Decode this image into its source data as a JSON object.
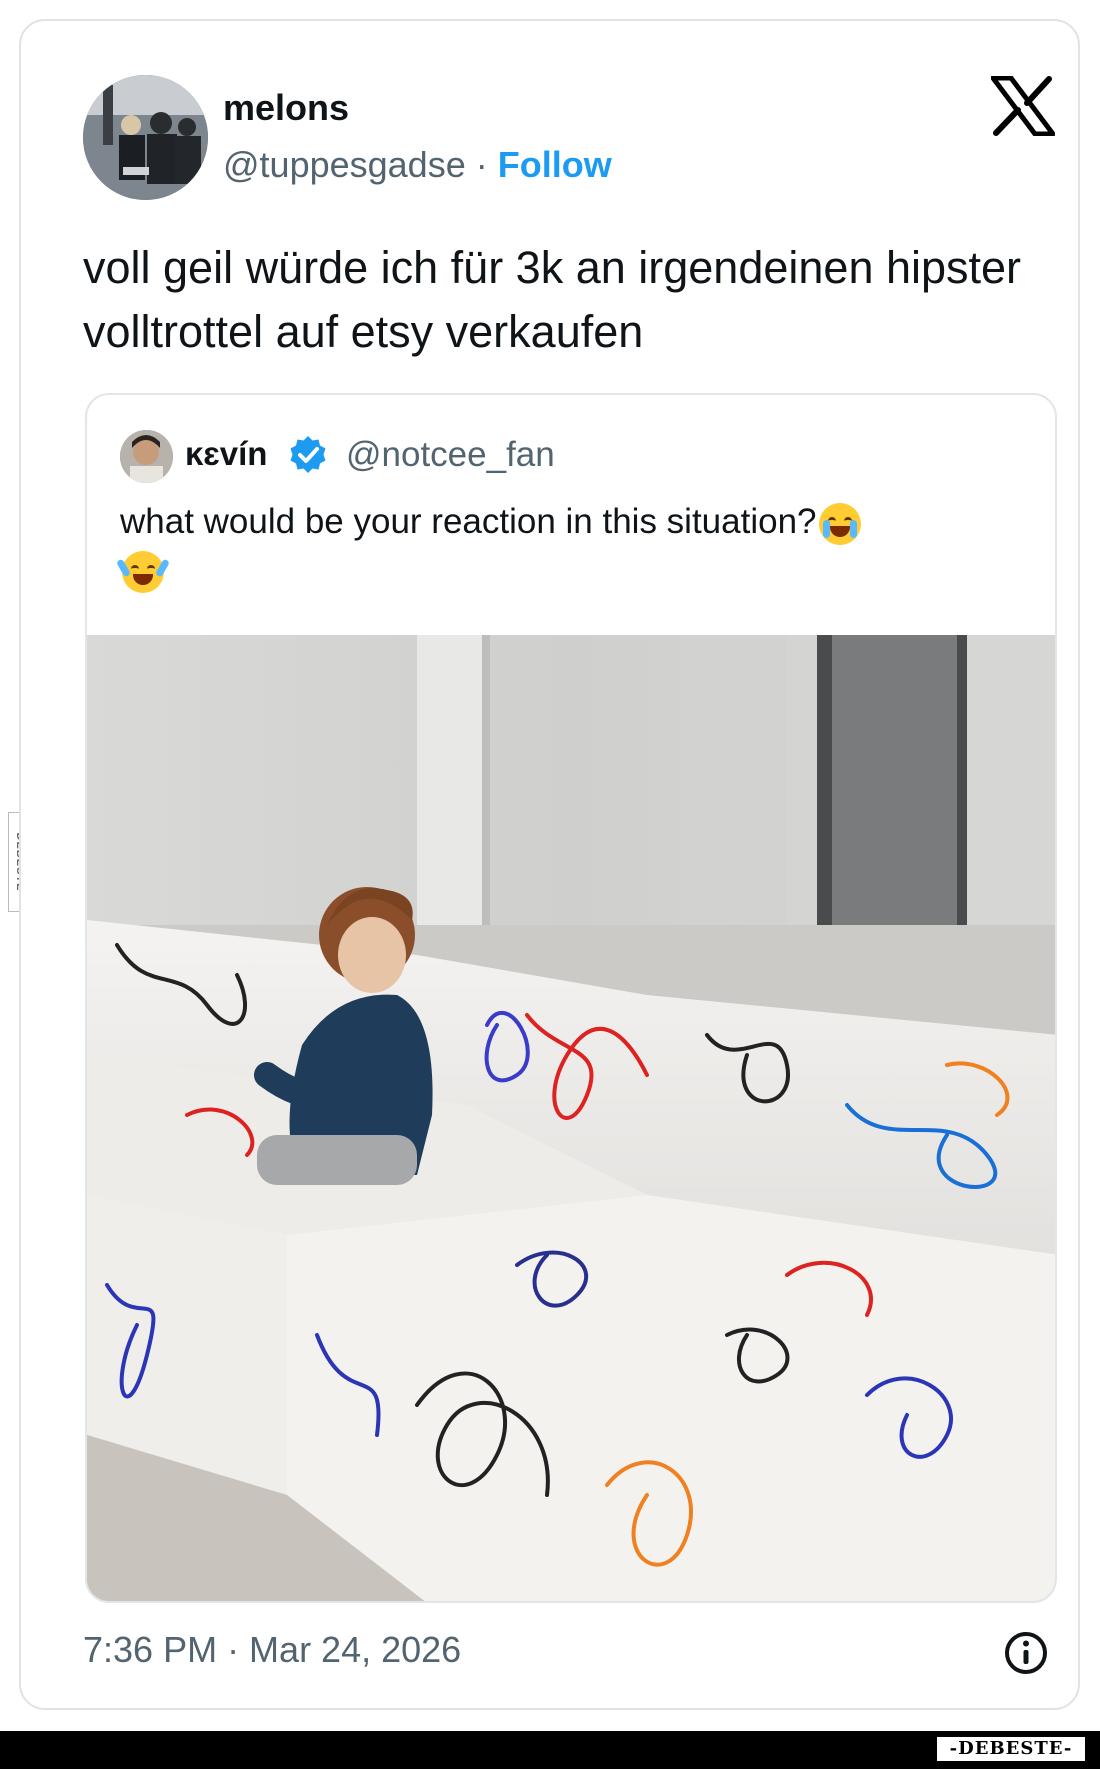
{
  "author": {
    "name": "melons",
    "handle": "@tuppesgadse",
    "separator": " · ",
    "follow_label": "Follow"
  },
  "tweet": {
    "text": "voll geil würde ich für 3k an irgendeinen hipster volltrottel auf etsy verkaufen",
    "timestamp": "7:36 PM · Mar 24, 2026"
  },
  "quoted": {
    "name": "ĸɛvín",
    "handle": "@notcee_fan",
    "text": "what would be your reaction in this situation?",
    "emoji_icons": [
      "loudly-crying-face-emoji",
      "face-with-tears-of-joy-emoji"
    ],
    "photo_description_icon": "child-on-scribbled-white-sofa-photo"
  },
  "watermark": {
    "side": "DEBESTE",
    "corner": "-DEBESTE-"
  },
  "colors": {
    "text": "#0f1419",
    "secondary": "#536471",
    "accent": "#1d9bf0",
    "border": "#dfe3e6"
  }
}
